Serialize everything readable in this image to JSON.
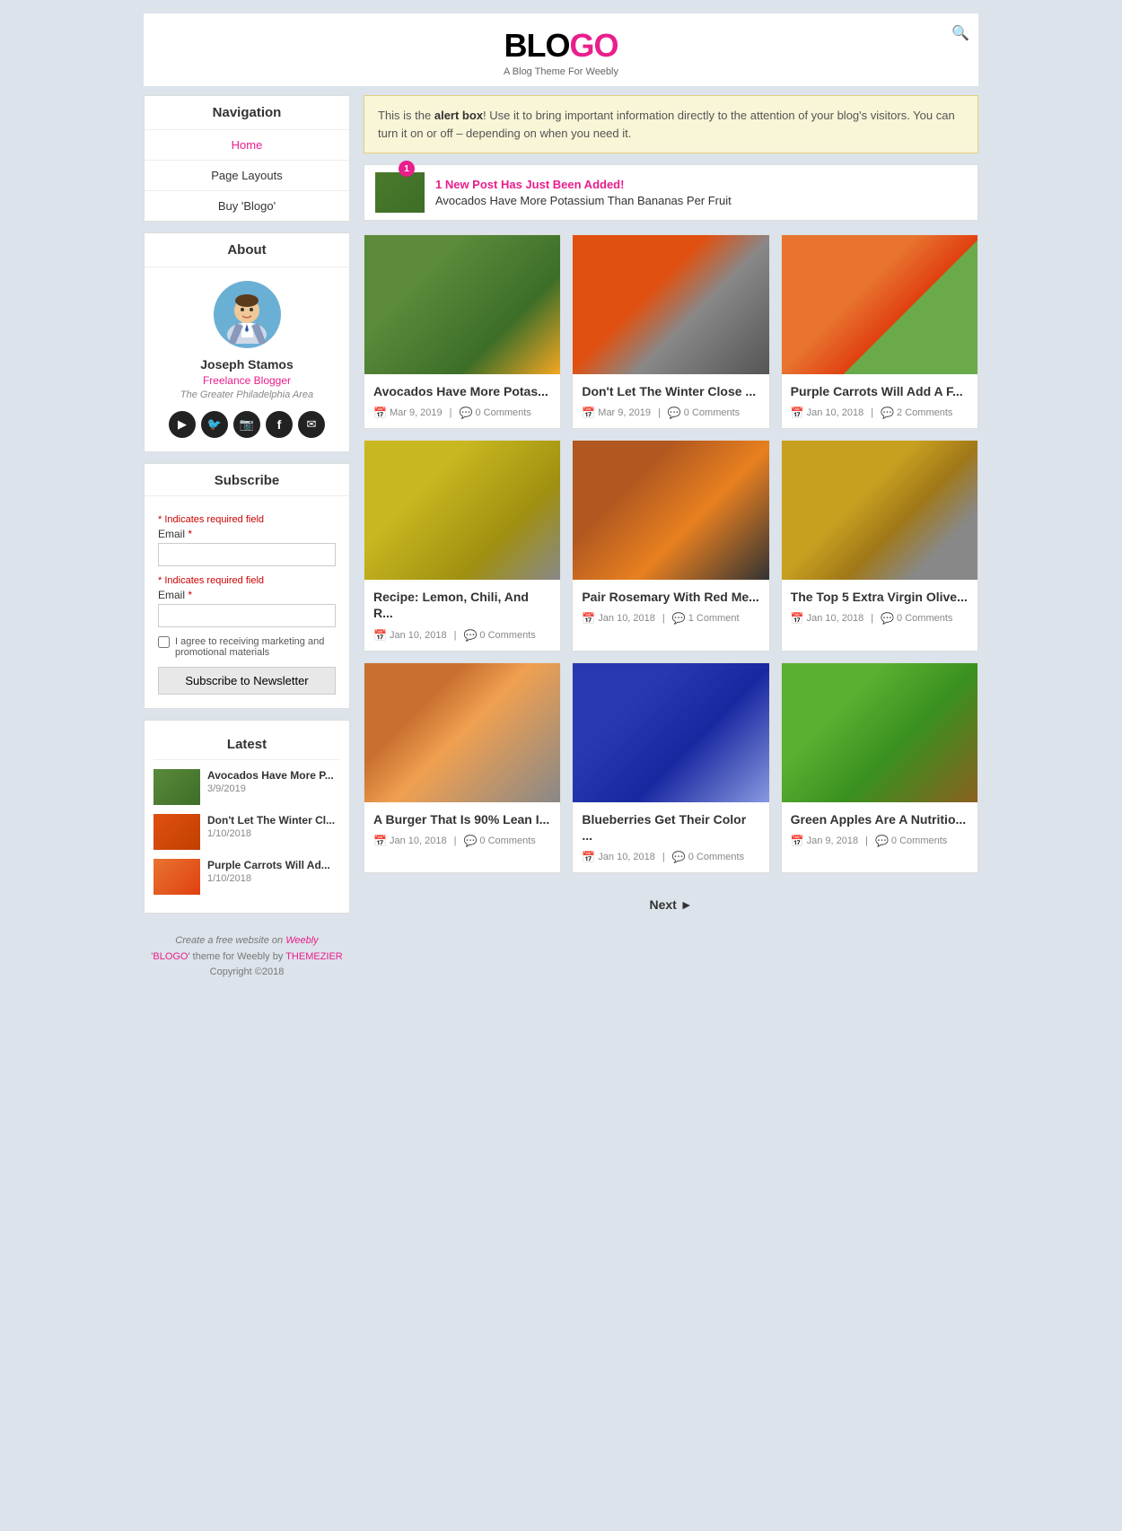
{
  "site": {
    "logo_blo": "BLO",
    "logo_go": "GO",
    "tagline": "A Blog Theme For Weebly"
  },
  "alert": {
    "text_before": "This is the ",
    "bold_text": "alert box",
    "text_after": "! Use it to bring important information directly to the attention of your blog's visitors. You can turn it on or off – depending on when you need it."
  },
  "new_post": {
    "badge": "1",
    "label": "1 New Post Has Just Been Added!",
    "title": "Avocados Have More Potassium Than Bananas Per Fruit"
  },
  "navigation": {
    "title": "Navigation",
    "links": [
      {
        "label": "Home",
        "active": true
      },
      {
        "label": "Page Layouts",
        "active": false
      },
      {
        "label": "Buy 'Blogo'",
        "active": false
      }
    ]
  },
  "about": {
    "title": "About",
    "author_name": "Joseph Stamos",
    "author_role": "Freelance Blogger",
    "author_location": "The Greater Philadelphia Area"
  },
  "social": {
    "icons": [
      "▶",
      "🐦",
      "📷",
      "f",
      "✉"
    ]
  },
  "subscribe": {
    "title": "Subscribe",
    "required_label": "* Indicates required field",
    "email_label": "Email",
    "required_star": "*",
    "checkbox_label": "I agree to receiving marketing and promotional materials",
    "button_label": "Subscribe to Newsletter"
  },
  "latest": {
    "title": "Latest",
    "posts": [
      {
        "title": "Avocados Have More P...",
        "date": "3/9/2019",
        "img_class": "img-avocado-small"
      },
      {
        "title": "Don't Let The Winter Cl...",
        "date": "1/10/2018",
        "img_class": "img-veggies-small"
      },
      {
        "title": "Purple Carrots Will Ad...",
        "date": "1/10/2018",
        "img_class": "img-carrots-small"
      }
    ]
  },
  "footer": {
    "line1": "Create a free website on ",
    "weebly_link": "Weebly",
    "line2": "'BLOGO' theme for Weebly by ",
    "themezier_link": "THEMEZIER",
    "line3": "Copyright ©2018"
  },
  "posts": [
    {
      "title": "Avocados Have More Potas...",
      "date": "Mar 9, 2019",
      "comments": "0 Comments",
      "img_class": "img-avocado"
    },
    {
      "title": "Don't Let The Winter Close ...",
      "date": "Mar 9, 2019",
      "comments": "0 Comments",
      "img_class": "img-veggies"
    },
    {
      "title": "Purple Carrots Will Add A F...",
      "date": "Jan 10, 2018",
      "comments": "2 Comments",
      "img_class": "img-carrots"
    },
    {
      "title": "Recipe: Lemon, Chili, And R...",
      "date": "Jan 10, 2018",
      "comments": "0 Comments",
      "img_class": "img-lemon"
    },
    {
      "title": "Pair Rosemary With Red Me...",
      "date": "Jan 10, 2018",
      "comments": "1 Comment",
      "img_class": "img-steak"
    },
    {
      "title": "The Top 5 Extra Virgin Olive...",
      "date": "Jan 10, 2018",
      "comments": "0 Comments",
      "img_class": "img-olive"
    },
    {
      "title": "A Burger That Is 90% Lean I...",
      "date": "Jan 10, 2018",
      "comments": "0 Comments",
      "img_class": "img-burger"
    },
    {
      "title": "Blueberries Get Their Color ...",
      "date": "Jan 10, 2018",
      "comments": "0 Comments",
      "img_class": "img-blueberry"
    },
    {
      "title": "Green Apples Are A Nutritio...",
      "date": "Jan 9, 2018",
      "comments": "0 Comments",
      "img_class": "img-apple"
    }
  ],
  "pagination": {
    "next_label": "Next ►"
  }
}
